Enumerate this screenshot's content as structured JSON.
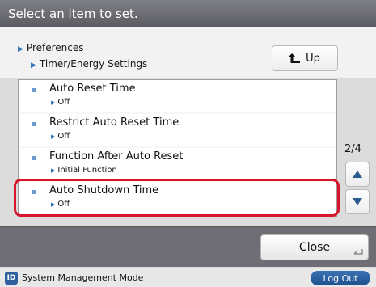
{
  "header": {
    "title": "Select an item to set."
  },
  "breadcrumb": {
    "level1": "Preferences",
    "level2": "Timer/Energy Settings"
  },
  "nav": {
    "up_label": "Up"
  },
  "list": {
    "items": [
      {
        "label": "Auto Reset Time",
        "value": "Off"
      },
      {
        "label": "Restrict Auto Reset Time",
        "value": "Off"
      },
      {
        "label": "Function After Auto Reset",
        "value": "Initial Function"
      },
      {
        "label": "Auto Shutdown Time",
        "value": "Off"
      }
    ],
    "page_indicator": "2/4",
    "highlighted_index": 3
  },
  "footer": {
    "close_label": "Close"
  },
  "status_bar": {
    "badge": "ID",
    "mode_text": "System Management Mode",
    "logout_label": "Log Out"
  },
  "colors": {
    "highlight": "#d8162b",
    "accent": "#2e74b8",
    "title_bar": "#6e6e74"
  }
}
